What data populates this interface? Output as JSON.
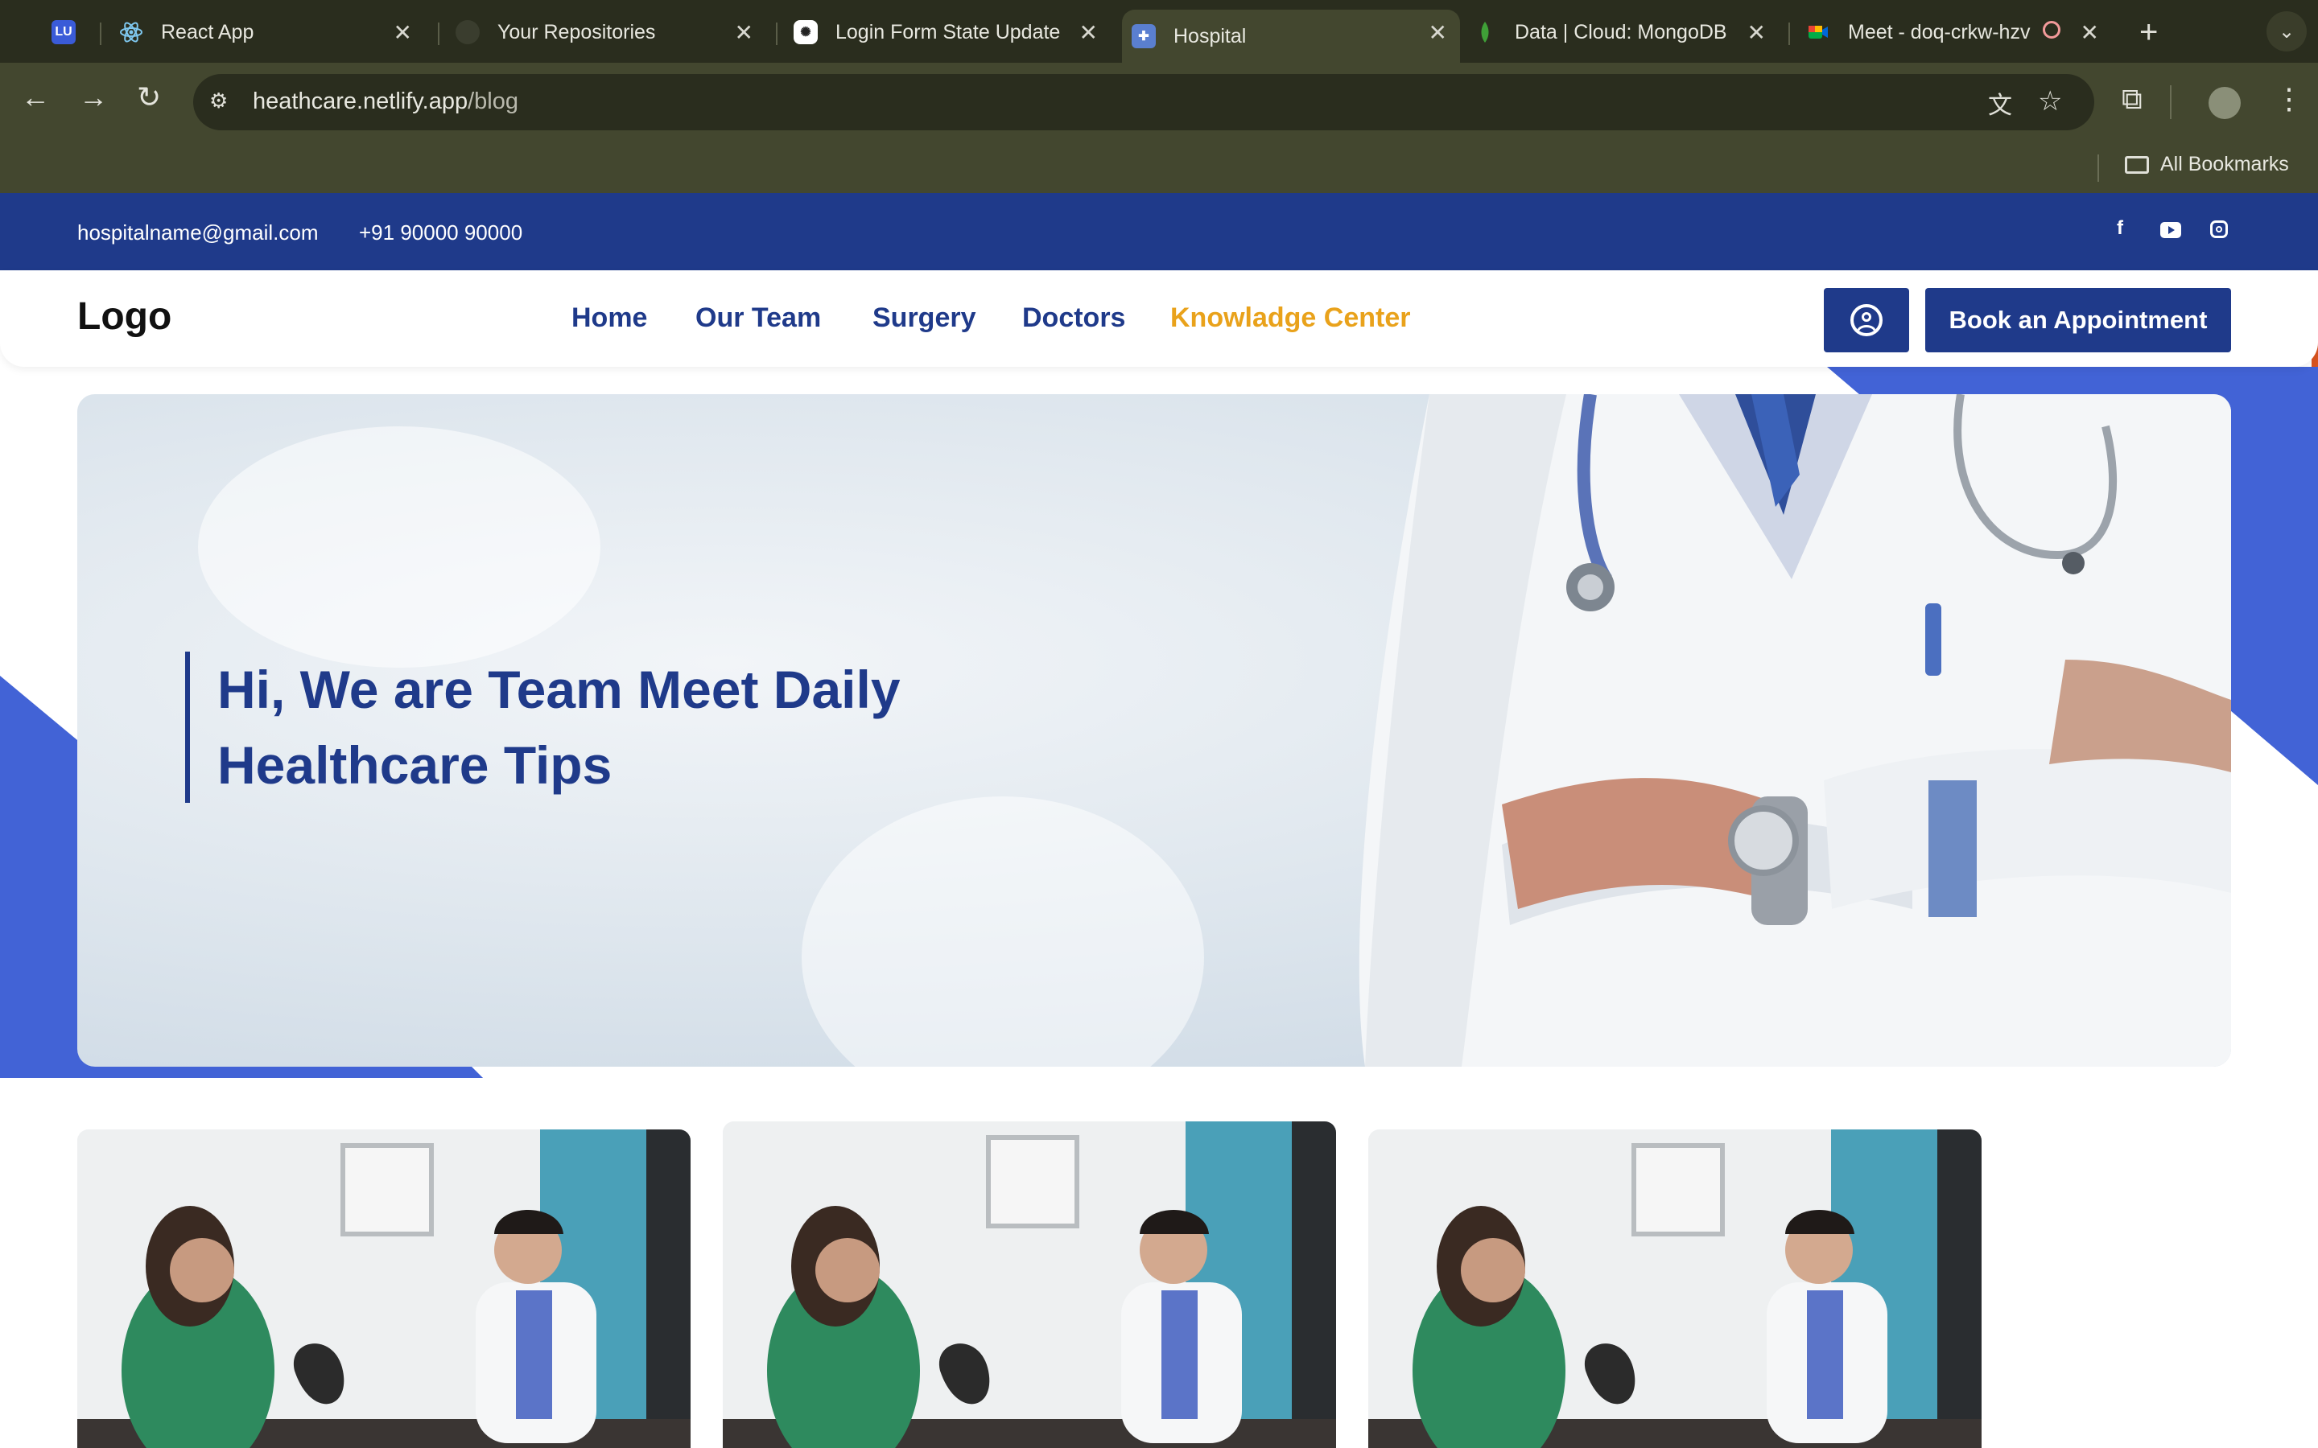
{
  "browser": {
    "tabs": [
      {
        "title": "",
        "icon": "lu-icon"
      },
      {
        "title": "React App",
        "icon": "react-icon"
      },
      {
        "title": "Your Repositories",
        "icon": "github-icon"
      },
      {
        "title": "Login Form State Update",
        "icon": "openai-icon"
      },
      {
        "title": "Hospital",
        "icon": "hospital-icon",
        "active": true
      },
      {
        "title": "Data | Cloud: MongoDB C",
        "icon": "mongodb-icon"
      },
      {
        "title": "Meet - doq-crkw-hzv",
        "icon": "meet-icon"
      }
    ],
    "url_host": "heathcare.netlify.app",
    "url_path": "/blog",
    "bookmarks_label": "All Bookmarks"
  },
  "site": {
    "topbar": {
      "email": "hospitalname@gmail.com",
      "phone": "+91 90000 90000"
    },
    "logo": "Logo",
    "nav": [
      "Home",
      "Our Team",
      "Surgery",
      "Doctors",
      "Knowladge Center"
    ],
    "active_nav": "Knowladge Center",
    "book_button": "Book an Appointment",
    "hero": {
      "line1": "Hi, We are Team Meet Daily",
      "line2": "Healthcare Tips"
    },
    "colors": {
      "primary": "#1f3a8a",
      "accent": "#e9a21b",
      "decor": "#4263d6"
    }
  }
}
